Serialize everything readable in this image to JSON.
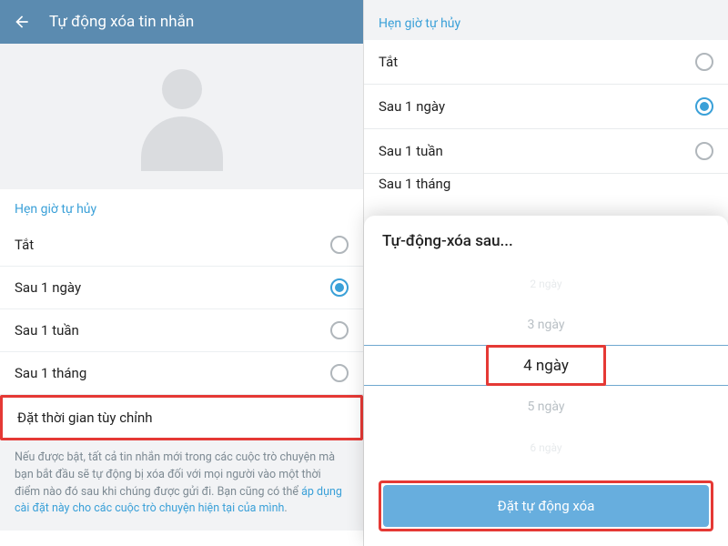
{
  "left": {
    "header_title": "Tự động xóa tin nhắn",
    "section_title": "Hẹn giờ tự hủy",
    "options": [
      {
        "label": "Tắt",
        "selected": false
      },
      {
        "label": "Sau 1 ngày",
        "selected": true
      },
      {
        "label": "Sau 1 tuần",
        "selected": false
      },
      {
        "label": "Sau 1 tháng",
        "selected": false
      }
    ],
    "custom_label": "Đặt thời gian tùy chỉnh",
    "footer_text": "Nếu được bật, tất cả tin nhắn mới trong các cuộc trò chuyện mà bạn bắt đầu sẽ tự động bị xóa đối với mọi người vào một thời điểm nào đó sau khi chúng được gửi đi. Bạn cũng có thể ",
    "footer_link": "áp dụng cài đặt này cho các cuộc trò chuyện hiện tại của mình",
    "footer_tail": "."
  },
  "right": {
    "section_title": "Hẹn giờ tự hủy",
    "options": [
      {
        "label": "Tắt",
        "selected": false
      },
      {
        "label": "Sau 1 ngày",
        "selected": true
      },
      {
        "label": "Sau 1 tuần",
        "selected": false
      },
      {
        "label": "Sau 1 tháng",
        "selected": false
      }
    ],
    "sheet_title": "Tự-động-xóa sau...",
    "wheel": {
      "items": [
        "2 ngày",
        "3 ngày",
        "4 ngày",
        "5 ngày",
        "6 ngày"
      ],
      "selected_index": 2
    },
    "confirm_label": "Đặt tự động xóa"
  }
}
